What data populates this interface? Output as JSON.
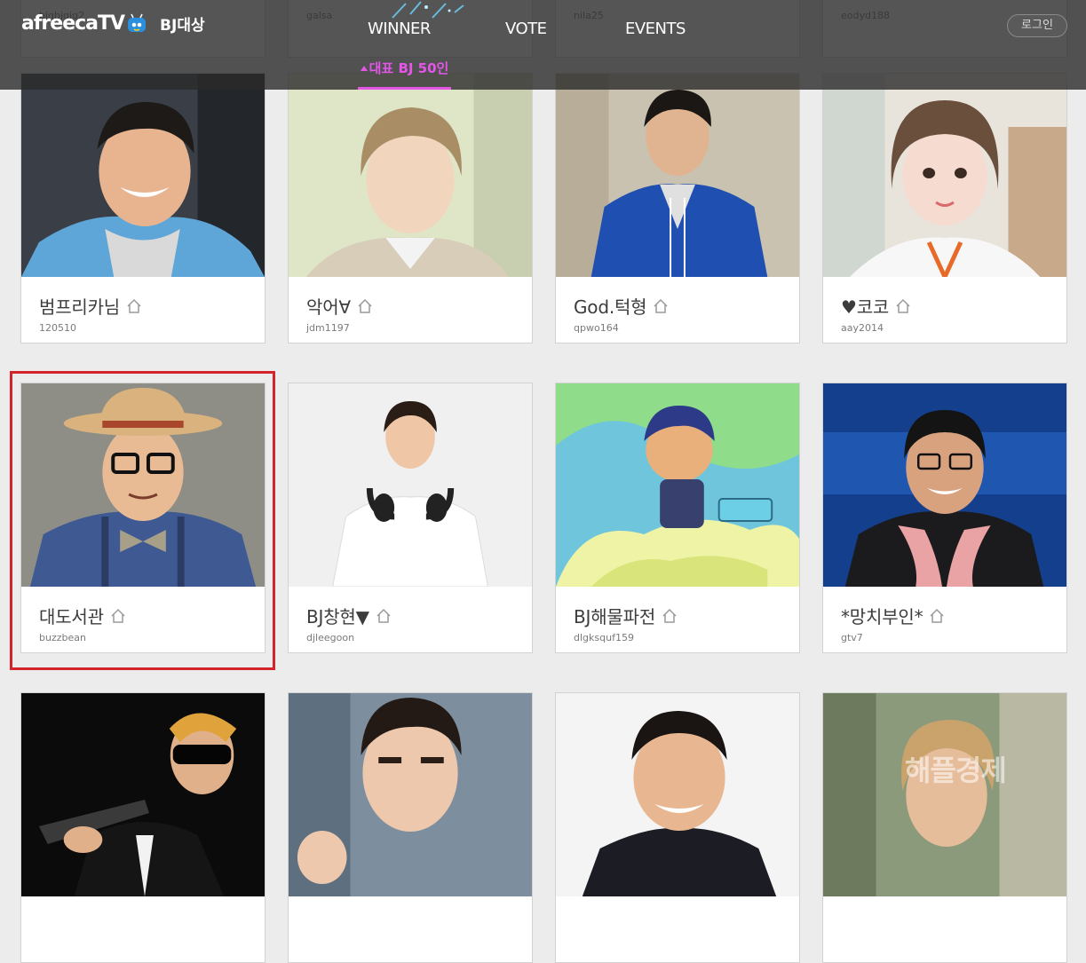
{
  "header": {
    "logo": "afreecaTV",
    "logo_sub": "BJ대상",
    "nav": [
      "WINNER",
      "VOTE",
      "EVENTS"
    ],
    "subnav": "대표 BJ 50인",
    "login": "로그인"
  },
  "top_row_ids": [
    "bjqbjqjq2",
    "galsa",
    "nila25",
    "eodyd188"
  ],
  "cards": [
    {
      "name": "범프리카님",
      "id": "120510"
    },
    {
      "name": "악어∀",
      "id": "jdm1197"
    },
    {
      "name": "God.턱형",
      "id": "qpwo164"
    },
    {
      "name": "♥코코",
      "id": "aay2014"
    },
    {
      "name": "대도서관",
      "id": "buzzbean"
    },
    {
      "name": "BJ창현▼",
      "id": "djleegoon"
    },
    {
      "name": "BJ해물파전",
      "id": "dlgksquf159"
    },
    {
      "name": "*망치부인*",
      "id": "gtv7"
    }
  ],
  "bottom_row_watermark": "해플경제",
  "colors": {
    "accent": "#e356e6",
    "highlight": "#d3232b",
    "header_bg": "rgba(42,42,42,0.80)"
  }
}
